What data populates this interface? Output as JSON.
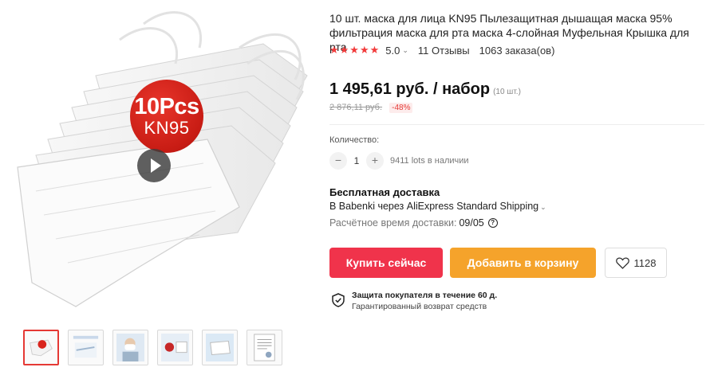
{
  "gallery": {
    "badge_line1": "10Pcs",
    "badge_line2": "KN95",
    "thumb_count": 6
  },
  "product": {
    "title": "10 шт. маска для лица KN95 Пылезащитная дышащая маска 95% фильтрация маска для рта маска 4-слойная Муфельная Крышка для рта",
    "rating": "5.0",
    "rating_stars": 5,
    "reviews": "11 Отзывы",
    "orders": "1063 заказа(ов)",
    "price": "1 495,61 руб. / набор",
    "price_unit": "(10 шт.)",
    "old_price": "2 876,11 руб.",
    "discount": "-48%"
  },
  "quantity": {
    "label": "Количество:",
    "value": "1",
    "minus": "−",
    "plus": "+",
    "stock": "9411 lots в наличии"
  },
  "shipping": {
    "title": "Бесплатная доставка",
    "route": "В Babenki через AliExpress Standard Shipping",
    "eta_label": "Расчётное время доставки:",
    "eta_date": "09/05"
  },
  "actions": {
    "buy_now": "Купить сейчас",
    "add_to_cart": "Добавить в корзину",
    "wishlist_count": "1128"
  },
  "protection": {
    "title": "Защита покупателя в течение 60 д.",
    "subtitle": "Гарантированный возврат средств"
  },
  "colors": {
    "star": "#f23c3c",
    "buy": "#f0334b",
    "cart": "#f5a32b",
    "badge": "#d9251d"
  }
}
